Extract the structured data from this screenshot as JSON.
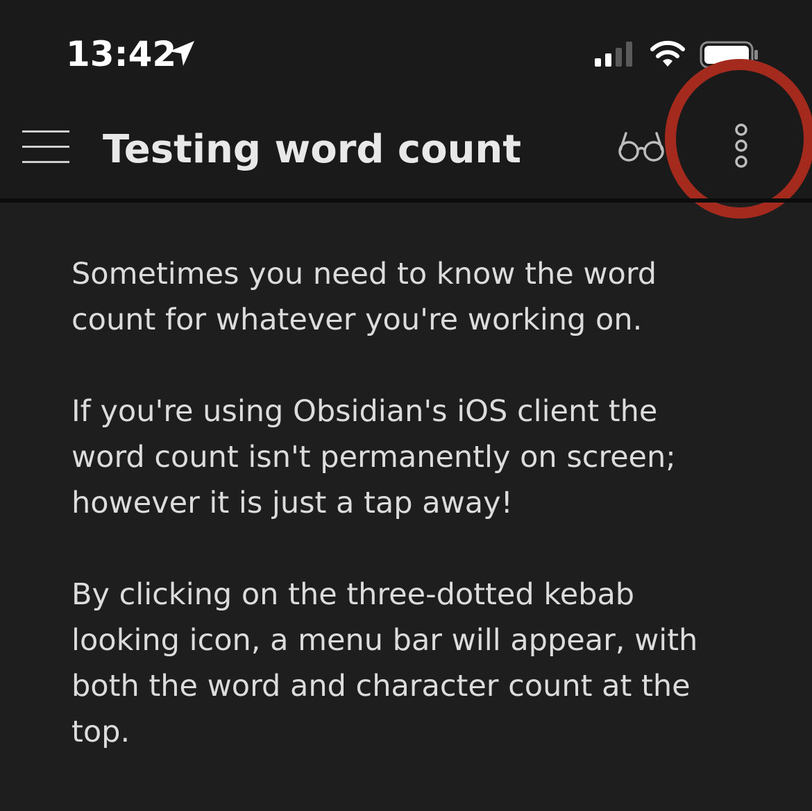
{
  "status_bar": {
    "time": "13:42",
    "location_icon": "location-arrow-icon",
    "signal_icon": "cellular-signal-icon",
    "wifi_icon": "wifi-icon",
    "battery_icon": "battery-icon"
  },
  "header": {
    "menu_icon": "hamburger-menu-icon",
    "title": "Testing word count",
    "reading_view_icon": "glasses-icon",
    "more_options_icon": "kebab-menu-icon"
  },
  "content": {
    "paragraphs": [
      {
        "lines": [
          "Sometimes you need to know the word",
          "count for whatever you're working on."
        ]
      },
      {
        "lines": [
          "If you're using Obsidian's iOS client the",
          "word count isn't permanently on screen;",
          "however it is just a tap away!"
        ]
      },
      {
        "lines": [
          "By clicking on the three-dotted kebab",
          "looking icon, a menu bar will appear, with",
          "both the word and character count at the",
          "top."
        ]
      }
    ]
  },
  "colors": {
    "background": "#1e1e1e",
    "header_background": "#1a1a1a",
    "text": "#dcdcdc",
    "title": "#e8e8e8",
    "highlight_ring": "#a52a1e"
  }
}
